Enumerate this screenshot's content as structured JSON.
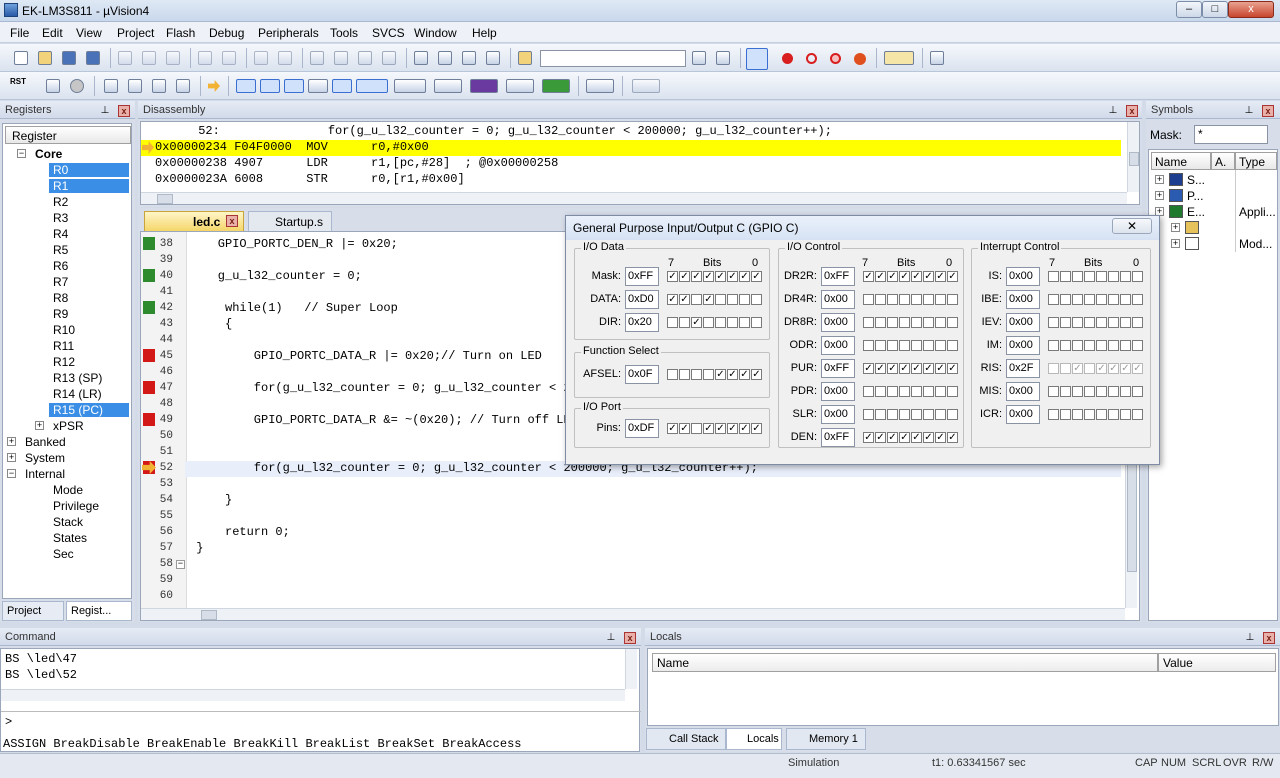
{
  "window": {
    "title": "EK-LM3S811  - µVision4",
    "minimize": "–",
    "maximize": "□",
    "close": "x"
  },
  "menu": [
    "File",
    "Edit",
    "View",
    "Project",
    "Flash",
    "Debug",
    "Peripherals",
    "Tools",
    "SVCS",
    "Window",
    "Help"
  ],
  "toolbar": {
    "rst_label": "RST"
  },
  "registers": {
    "title": "Registers",
    "column": "Register",
    "core_label": "Core",
    "core": [
      "R0",
      "R1",
      "R2",
      "R3",
      "R4",
      "R5",
      "R6",
      "R7",
      "R8",
      "R9",
      "R10",
      "R11",
      "R12",
      "R13 (SP)",
      "R14 (LR)",
      "R15 (PC)",
      "xPSR"
    ],
    "groups": [
      "Banked",
      "System",
      "Internal"
    ],
    "internal": [
      "Mode",
      "Privilege",
      "Stack",
      "States",
      "Sec"
    ],
    "tabs": [
      "Project",
      "Regist..."
    ]
  },
  "disassembly": {
    "title": "Disassembly",
    "lines": [
      "      52:               for(g_u_l32_counter = 0; g_u_l32_counter < 200000; g_u_l32_counter++);",
      "0x00000234 F04F0000  MOV      r0,#0x00",
      "0x00000238 4907      LDR      r1,[pc,#28]  ; @0x00000258",
      "0x0000023A 6008      STR      r0,[r1,#0x00]"
    ]
  },
  "editor": {
    "tabs": [
      "led.c",
      "Startup.s"
    ],
    "lines": [
      {
        "n": "38",
        "t": "    GPIO_PORTC_DEN_R |= 0x20;"
      },
      {
        "n": "39",
        "t": ""
      },
      {
        "n": "40",
        "t": "    g_u_l32_counter = 0;"
      },
      {
        "n": "41",
        "t": ""
      },
      {
        "n": "42",
        "t": "     while(1)   // Super Loop"
      },
      {
        "n": "43",
        "t": "     {"
      },
      {
        "n": "44",
        "t": ""
      },
      {
        "n": "45",
        "t": "         GPIO_PORTC_DATA_R |= 0x20;// Turn on LED"
      },
      {
        "n": "46",
        "t": ""
      },
      {
        "n": "47",
        "t": "         for(g_u_l32_counter = 0; g_u_l32_counter < 200000; g_u_l32_counter++);"
      },
      {
        "n": "48",
        "t": ""
      },
      {
        "n": "49",
        "t": "         GPIO_PORTC_DATA_R &= ~(0x20); // Turn off LED"
      },
      {
        "n": "50",
        "t": ""
      },
      {
        "n": "51",
        "t": ""
      },
      {
        "n": "52",
        "t": "         for(g_u_l32_counter = 0; g_u_l32_counter < 200000; g_u_l32_counter++);"
      },
      {
        "n": "53",
        "t": ""
      },
      {
        "n": "54",
        "t": "     }"
      },
      {
        "n": "55",
        "t": ""
      },
      {
        "n": "56",
        "t": "     return 0;"
      },
      {
        "n": "57",
        "t": " }"
      },
      {
        "n": "58",
        "t": ""
      },
      {
        "n": "59",
        "t": ""
      },
      {
        "n": "60",
        "t": ""
      }
    ]
  },
  "symbols": {
    "title": "Symbols",
    "mask_label": "Mask:",
    "mask_value": "*",
    "columns": [
      "Name",
      "A.",
      "Type"
    ],
    "rows": [
      {
        "name": "S...",
        "type": ""
      },
      {
        "name": "P...",
        "type": ""
      },
      {
        "name": "E...",
        "type": "Appli..."
      },
      {
        "name": "",
        "type": ""
      },
      {
        "name": "",
        "type": "Mod..."
      }
    ]
  },
  "gpio": {
    "title": "General Purpose Input/Output C (GPIO C)",
    "bits_label": "Bits",
    "bit_hi": "7",
    "bit_lo": "0",
    "io_data": {
      "title": "I/O Data",
      "rows": [
        {
          "label": "Mask:",
          "value": "0xFF",
          "bits": [
            1,
            1,
            1,
            1,
            1,
            1,
            1,
            1
          ]
        },
        {
          "label": "DATA:",
          "value": "0xD0",
          "bits": [
            1,
            1,
            0,
            1,
            0,
            0,
            0,
            0
          ]
        },
        {
          "label": "DIR:",
          "value": "0x20",
          "bits": [
            0,
            0,
            1,
            0,
            0,
            0,
            0,
            0
          ]
        }
      ]
    },
    "function_select": {
      "title": "Function Select",
      "rows": [
        {
          "label": "AFSEL:",
          "value": "0x0F",
          "bits": [
            0,
            0,
            0,
            0,
            1,
            1,
            1,
            1
          ]
        }
      ]
    },
    "io_port": {
      "title": "I/O Port",
      "rows": [
        {
          "label": "Pins:",
          "value": "0xDF",
          "bits": [
            1,
            1,
            0,
            1,
            1,
            1,
            1,
            1
          ]
        }
      ]
    },
    "io_control": {
      "title": "I/O Control",
      "rows": [
        {
          "label": "DR2R:",
          "value": "0xFF",
          "bits": [
            1,
            1,
            1,
            1,
            1,
            1,
            1,
            1
          ]
        },
        {
          "label": "DR4R:",
          "value": "0x00",
          "bits": [
            0,
            0,
            0,
            0,
            0,
            0,
            0,
            0
          ]
        },
        {
          "label": "DR8R:",
          "value": "0x00",
          "bits": [
            0,
            0,
            0,
            0,
            0,
            0,
            0,
            0
          ]
        },
        {
          "label": "ODR:",
          "value": "0x00",
          "bits": [
            0,
            0,
            0,
            0,
            0,
            0,
            0,
            0
          ]
        },
        {
          "label": "PUR:",
          "value": "0xFF",
          "bits": [
            1,
            1,
            1,
            1,
            1,
            1,
            1,
            1
          ]
        },
        {
          "label": "PDR:",
          "value": "0x00",
          "bits": [
            0,
            0,
            0,
            0,
            0,
            0,
            0,
            0
          ]
        },
        {
          "label": "SLR:",
          "value": "0x00",
          "bits": [
            0,
            0,
            0,
            0,
            0,
            0,
            0,
            0
          ]
        },
        {
          "label": "DEN:",
          "value": "0xFF",
          "bits": [
            1,
            1,
            1,
            1,
            1,
            1,
            1,
            1
          ]
        }
      ]
    },
    "interrupt_control": {
      "title": "Interrupt Control",
      "rows": [
        {
          "label": "IS:",
          "value": "0x00",
          "bits": [
            0,
            0,
            0,
            0,
            0,
            0,
            0,
            0
          ]
        },
        {
          "label": "IBE:",
          "value": "0x00",
          "bits": [
            0,
            0,
            0,
            0,
            0,
            0,
            0,
            0
          ]
        },
        {
          "label": "IEV:",
          "value": "0x00",
          "bits": [
            0,
            0,
            0,
            0,
            0,
            0,
            0,
            0
          ]
        },
        {
          "label": "IM:",
          "value": "0x00",
          "bits": [
            0,
            0,
            0,
            0,
            0,
            0,
            0,
            0
          ]
        },
        {
          "label": "RIS:",
          "value": "0x2F",
          "bits": [
            0,
            0,
            1,
            0,
            1,
            1,
            1,
            1
          ]
        },
        {
          "label": "MIS:",
          "value": "0x00",
          "bits": [
            0,
            0,
            0,
            0,
            0,
            0,
            0,
            0
          ]
        },
        {
          "label": "ICR:",
          "value": "0x00",
          "bits": [
            0,
            0,
            0,
            0,
            0,
            0,
            0,
            0
          ]
        }
      ]
    }
  },
  "command": {
    "title": "Command",
    "lines": [
      "BS \\led\\47",
      "BS \\led\\52"
    ],
    "prompt": ">",
    "help": "ASSIGN BreakDisable BreakEnable BreakKill BreakList BreakSet BreakAccess"
  },
  "locals": {
    "title": "Locals",
    "columns": [
      "Name",
      "Value"
    ],
    "tabs": [
      "Call Stack",
      "Locals",
      "Memory 1"
    ]
  },
  "status": {
    "mode": "Simulation",
    "time": "t1: 0.63341567 sec",
    "indicators": [
      "CAP",
      "NUM",
      "SCRL",
      "OVR",
      "R/W"
    ]
  }
}
